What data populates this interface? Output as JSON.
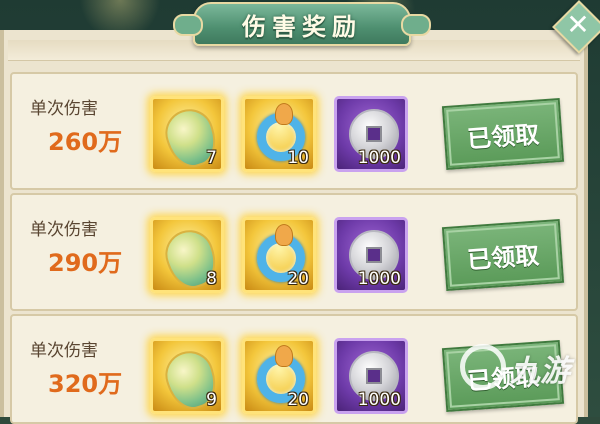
{
  "title": "伤害奖励",
  "close_icon_glyph": "✕",
  "rows": [
    {
      "label": "单次伤害",
      "value": "260万",
      "items": [
        {
          "icon": "jade-pendant-icon",
          "qty": "7"
        },
        {
          "icon": "jade-ring-icon",
          "qty": "10"
        },
        {
          "icon": "silver-coin-icon",
          "qty": "1000"
        }
      ],
      "button": "已领取"
    },
    {
      "label": "单次伤害",
      "value": "290万",
      "items": [
        {
          "icon": "jade-pendant-icon",
          "qty": "8"
        },
        {
          "icon": "jade-ring-icon",
          "qty": "20"
        },
        {
          "icon": "silver-coin-icon",
          "qty": "1000"
        }
      ],
      "button": "已领取"
    },
    {
      "label": "单次伤害",
      "value": "320万",
      "items": [
        {
          "icon": "jade-pendant-icon",
          "qty": "9"
        },
        {
          "icon": "jade-ring-icon",
          "qty": "20"
        },
        {
          "icon": "silver-coin-icon",
          "qty": "1000"
        }
      ],
      "button": "已领取"
    }
  ],
  "watermark": "九游",
  "colors": {
    "accent_green": "#5a9a58",
    "damage_orange": "#e06a1c",
    "gold_frame": "#f3c63b",
    "purple_frame": "#6d3aa8"
  }
}
